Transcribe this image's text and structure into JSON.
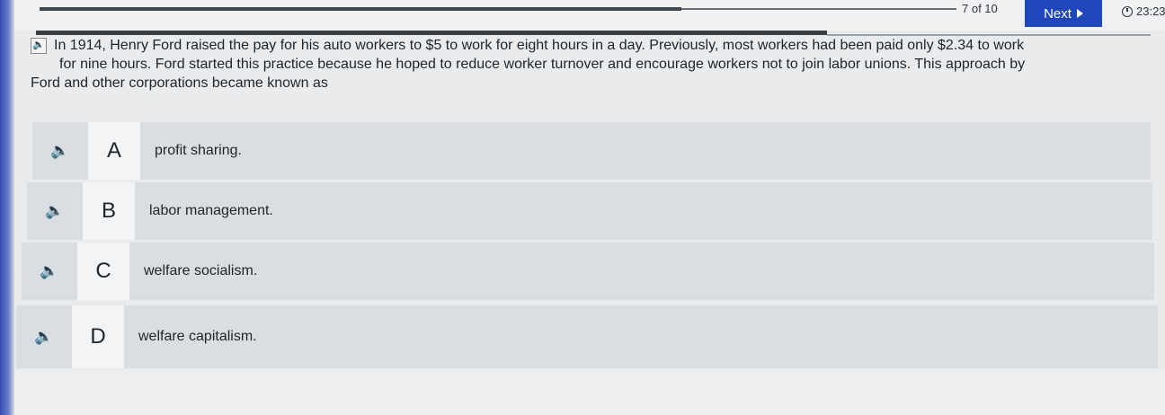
{
  "header": {
    "progress": {
      "current": 7,
      "total": 10
    },
    "counter_text": "7 of 10",
    "next_label": "Next",
    "timer": "23:23"
  },
  "question": {
    "line1": "In 1914, Henry Ford raised the pay for his auto workers to $5 to work for eight hours in a day. Previously, most workers had been paid only $2.34 to work",
    "line2": "for nine hours. Ford started this practice because he hoped to reduce worker turnover and encourage workers not to join labor unions. This approach by",
    "line3": "Ford and other corporations became known as"
  },
  "options": [
    {
      "letter": "A",
      "text": "profit sharing."
    },
    {
      "letter": "B",
      "text": "labor management."
    },
    {
      "letter": "C",
      "text": "welfare socialism."
    },
    {
      "letter": "D",
      "text": "welfare capitalism."
    }
  ],
  "colors": {
    "accent": "#1f47b9",
    "option_bg": "#d9dee2",
    "letter_bg": "#f3f4f5"
  },
  "icons": {
    "audio": "speaker-muted-icon",
    "next": "play-icon",
    "timer": "clock-icon"
  }
}
